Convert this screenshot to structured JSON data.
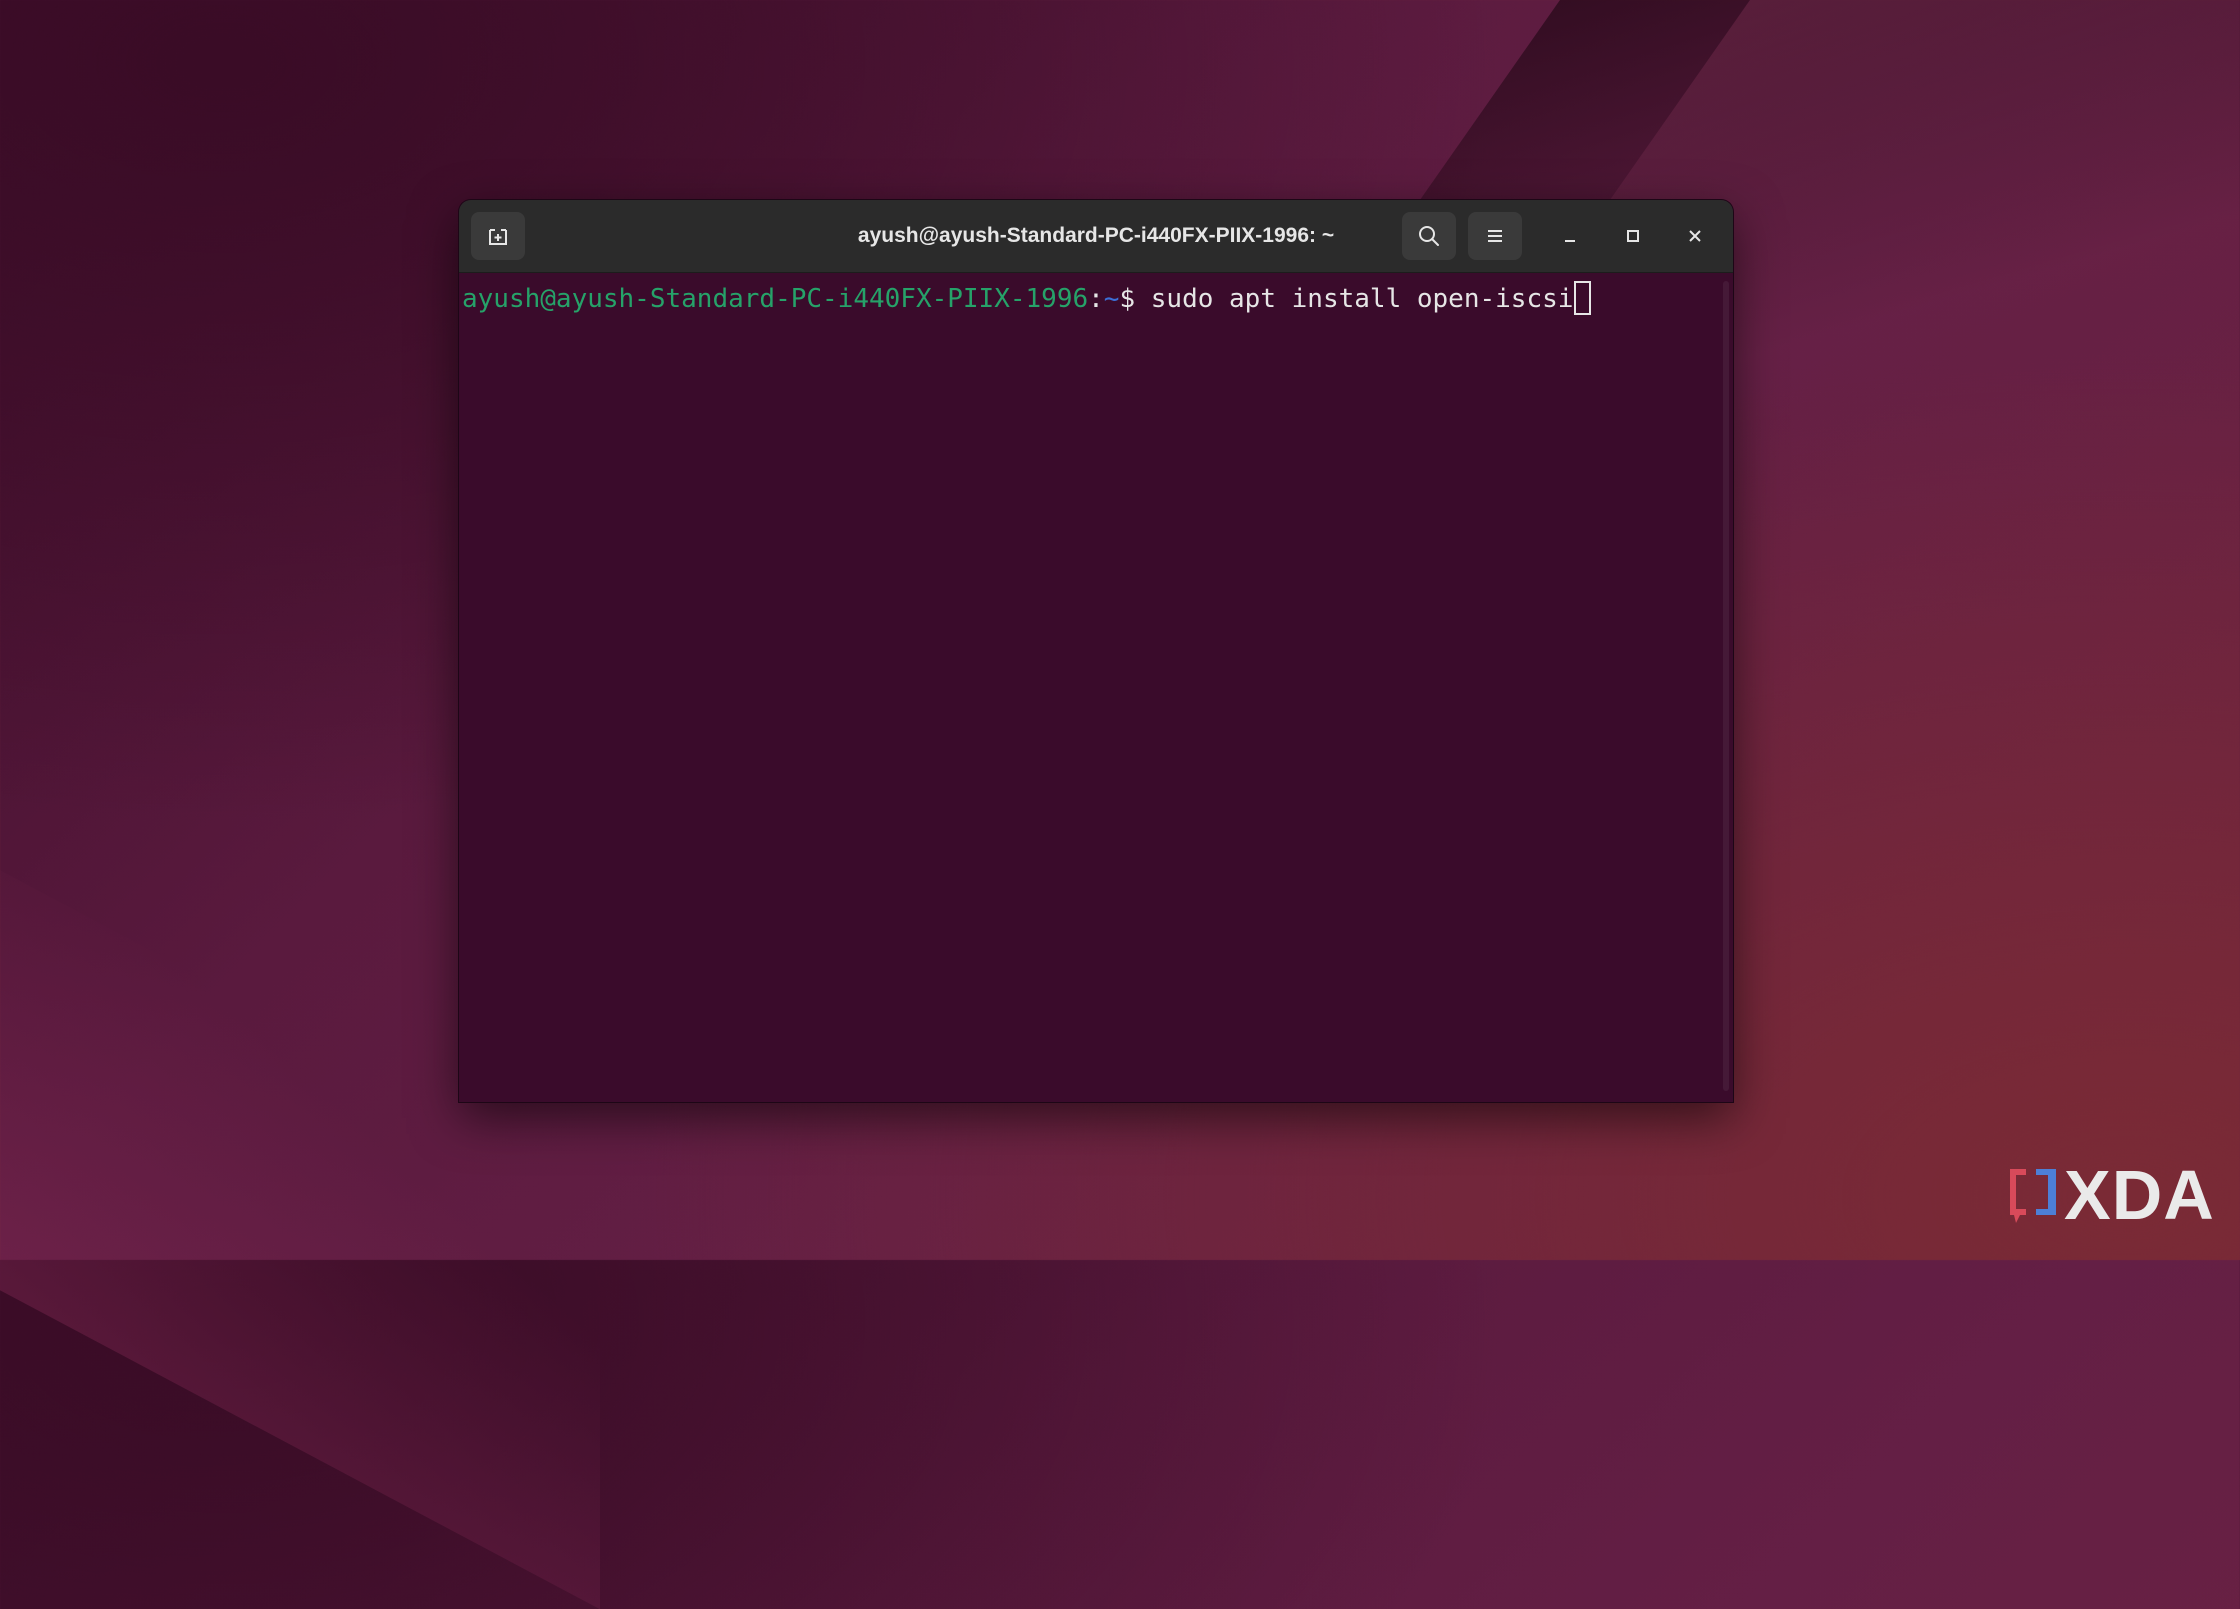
{
  "window": {
    "title": "ayush@ayush-Standard-PC-i440FX-PIIX-1996: ~",
    "buttons": {
      "new_tab_icon": "new-tab-icon",
      "search_icon": "search-icon",
      "menu_icon": "hamburger-menu-icon",
      "minimize_icon": "minimize-icon",
      "maximize_icon": "maximize-icon",
      "close_icon": "close-icon"
    }
  },
  "terminal": {
    "prompt_user": "ayush@ayush-Standard-PC-i440FX-PIIX-1996",
    "prompt_sep": ":",
    "prompt_path": "~",
    "prompt_symbol": "$ ",
    "command": "sudo apt install open-iscsi"
  },
  "watermark": {
    "text": "XDA"
  },
  "colors": {
    "prompt_user": "#26a269",
    "prompt_path": "#3b6fd6",
    "terminal_bg": "#3a0b2b",
    "titlebar_bg": "#2b2b2b",
    "text": "#e6e6e6"
  }
}
